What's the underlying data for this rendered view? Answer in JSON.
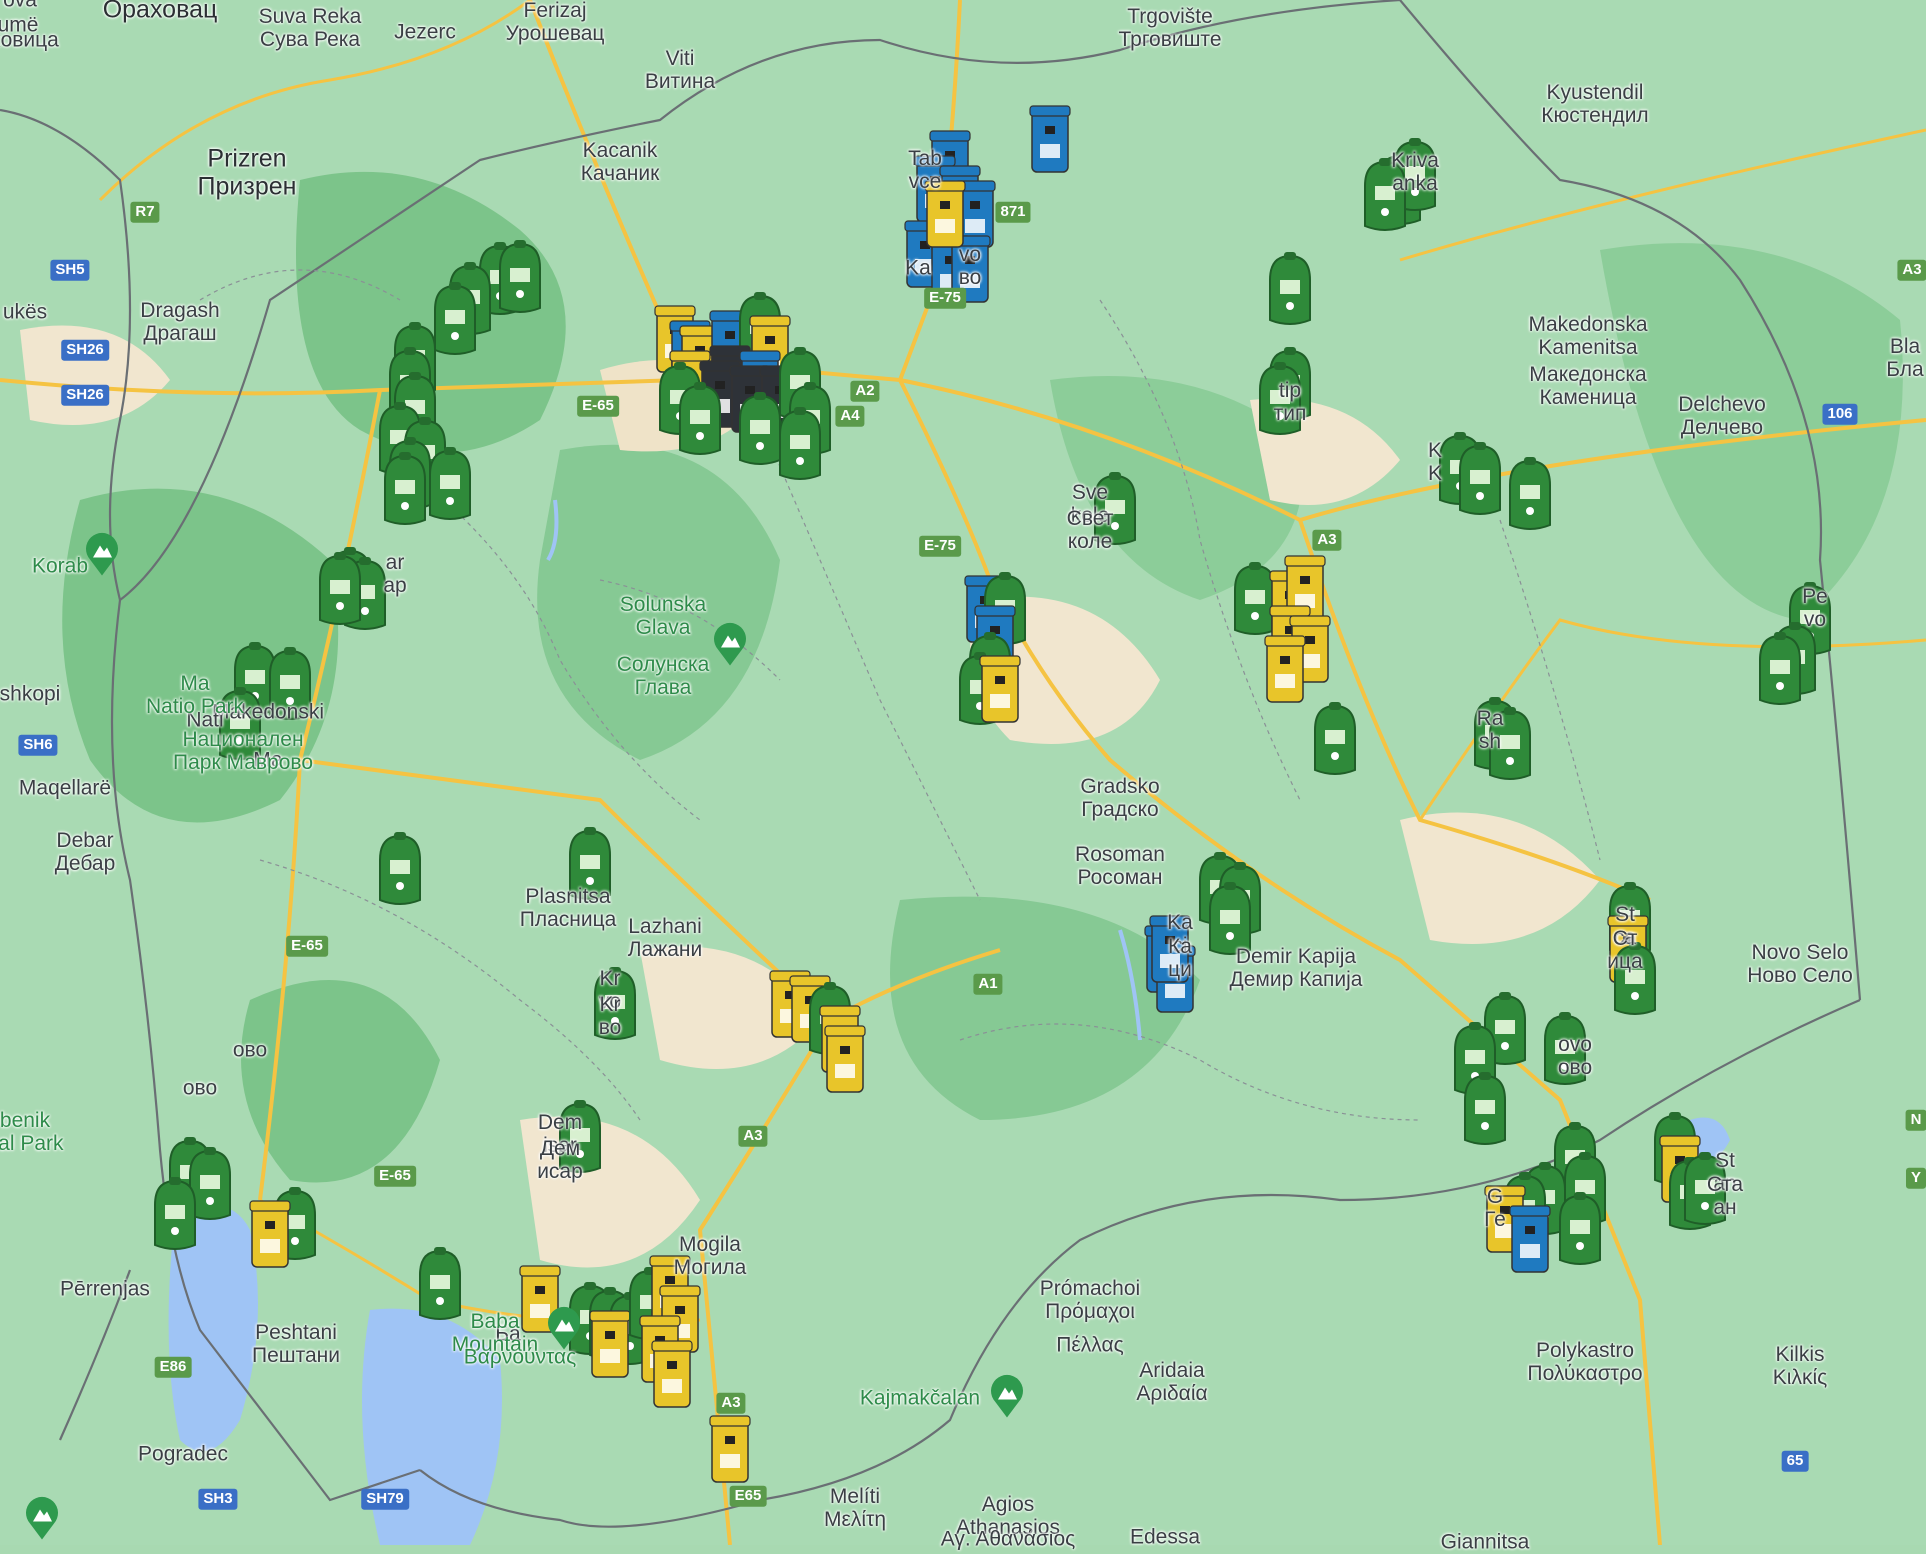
{
  "map": {
    "colors": {
      "land_green": "#a8d9b1",
      "forest": "#6cbf7a",
      "lowland": "#f2e6cf",
      "water": "#9fc4f5",
      "road": "#f5c342",
      "border": "#6a6f74",
      "bin_green": "#2f8a3a",
      "bin_blue": "#1f7ac0",
      "bin_yellow": "#e8c52a",
      "bin_dark": "#2e3238"
    }
  },
  "places": [
    {
      "l1": "Ораховац",
      "l2": ""
    },
    {
      "l1": "Suva Reka",
      "l2": "Сува Река"
    },
    {
      "l1": "Jezerc",
      "l2": ""
    },
    {
      "l1": "Ferizaj",
      "l2": "Урошевац"
    },
    {
      "l1": "Viti",
      "l2": "Витина"
    },
    {
      "l1": "Trgovište",
      "l2": "Трговиште"
    },
    {
      "l1": "Kacanik",
      "l2": "Качаник"
    },
    {
      "l1": "Prizren",
      "l2": "Призрен"
    },
    {
      "l1": "Kyustendil",
      "l2": "Кюстендил"
    },
    {
      "l1": "Dragash",
      "l2": "Драгаш"
    },
    {
      "l1": "Makedonska",
      "l2": "Kamenitsa"
    },
    {
      "l1": "Македонска",
      "l2": "Каменица"
    },
    {
      "l1": "Delchevo",
      "l2": "Делчево"
    },
    {
      "l1": "Plasnitsa",
      "l2": "Пласница"
    },
    {
      "l1": "Lazhani",
      "l2": "Лажани"
    },
    {
      "l1": "Gradsko",
      "l2": "Градско"
    },
    {
      "l1": "Rosoman",
      "l2": "Росоман"
    },
    {
      "l1": "Demir Kapija",
      "l2": "Демир Капија"
    },
    {
      "l1": "Novo Selo",
      "l2": "Ново Село"
    },
    {
      "l1": "Debar",
      "l2": "Дебар"
    },
    {
      "l1": "Pērrenjas",
      "l2": ""
    },
    {
      "l1": "Peshtani",
      "l2": "Пештани"
    },
    {
      "l1": "Pogradec",
      "l2": ""
    },
    {
      "l1": "Mogila",
      "l2": "Могила"
    },
    {
      "l1": "Prómachoi",
      "l2": "Πρόμαχοι"
    },
    {
      "l1": "Πέλλας",
      "l2": ""
    },
    {
      "l1": "Aridaia",
      "l2": "Αριδαία"
    },
    {
      "l1": "Polykastro",
      "l2": "Πολύκαστρο"
    },
    {
      "l1": "Kilkis",
      "l2": "Κιλκίς"
    },
    {
      "l1": "Agios",
      "l2": "Athanasios"
    },
    {
      "l1": "Αγ. Αθανάσιος",
      "l2": ""
    },
    {
      "l1": "Melíti",
      "l2": "Μελίτη"
    },
    {
      "l1": "Edessa",
      "l2": ""
    },
    {
      "l1": "Giannitsa",
      "l2": ""
    },
    {
      "l1": "Maqellarë",
      "l2": ""
    },
    {
      "l1": "shkopi",
      "l2": ""
    },
    {
      "l1": "ukës",
      "l2": ""
    },
    {
      "l1": "umë",
      "l2": ""
    },
    {
      "l1": "Tab",
      "l2": "vce"
    },
    {
      "l1": "Kriva",
      "l2": "anka"
    },
    {
      "l1": "Sve",
      "l2": "kole"
    },
    {
      "l1": "Свет",
      "l2": "коле"
    },
    {
      "l1": "Dem",
      "l2": "isar"
    },
    {
      "l1": "Дем",
      "l2": "исар"
    },
    {
      "l1": "Kr",
      "l2": "vo"
    },
    {
      "l1": "Kr",
      "l2": "во"
    },
    {
      "l1": "St",
      "l2": "ca"
    },
    {
      "l1": "Ст",
      "l2": "ица"
    },
    {
      "l1": "Ka",
      "l2": "ci"
    },
    {
      "l1": "Ка",
      "l2": "ци"
    },
    {
      "l1": "Pe",
      "l2": "vo"
    },
    {
      "l1": "Ra",
      "l2": "sh"
    },
    {
      "l1": "Bla",
      "l2": "Бла"
    },
    {
      "l1": "Makedonski",
      "l2": ""
    },
    {
      "l1": "Ма",
      "l2": ""
    },
    {
      "l1": "Ба",
      "l2": ""
    },
    {
      "l1": "ar",
      "l2": "ар"
    },
    {
      "l1": "St",
      "l2": "an"
    },
    {
      "l1": "Ста",
      "l2": "ан"
    },
    {
      "l1": "G",
      "l2": "Ге"
    },
    {
      "l1": "ovo",
      "l2": "ово"
    },
    {
      "l1": "tip",
      "l2": "тип"
    },
    {
      "l1": "vo",
      "l2": "во"
    },
    {
      "l1": "K",
      "l2": "K"
    },
    {
      "l1": "Ka",
      "l2": ""
    },
    {
      "l1": "ово",
      "l2": ""
    },
    {
      "l1": "ово",
      "l2": ""
    },
    {
      "l1": "ковица",
      "l2": ""
    },
    {
      "l1": "ova",
      "l2": ""
    },
    {
      "l1": "Nati",
      "l2": ""
    }
  ],
  "parks": [
    {
      "l1": "Solunska",
      "l2": "Glava"
    },
    {
      "l1": "Солунска",
      "l2": "Глава"
    },
    {
      "l1": "Korab",
      "l2": ""
    },
    {
      "l1": "Kajmakčalan",
      "l2": ""
    },
    {
      "l1": "Baba",
      "l2": "Mountain"
    },
    {
      "l1": "Βαρνούντας",
      "l2": ""
    },
    {
      "l1": "Национален",
      "l2": "Парк Маврово"
    },
    {
      "l1": "benik",
      "l2": "nal Park"
    },
    {
      "l1": "Ma",
      "l2": "Natio Park"
    }
  ],
  "shields": [
    "R7",
    "SH5",
    "SH26",
    "SH26",
    "SH6",
    "E-65",
    "E-65",
    "E-65",
    "A2",
    "A4",
    "E-75",
    "A3",
    "A1",
    "A3",
    "A3",
    "E65",
    "871",
    "E-75",
    "E86",
    "SH3",
    "SH79",
    "106",
    "65",
    "A3",
    "N",
    "Y"
  ]
}
